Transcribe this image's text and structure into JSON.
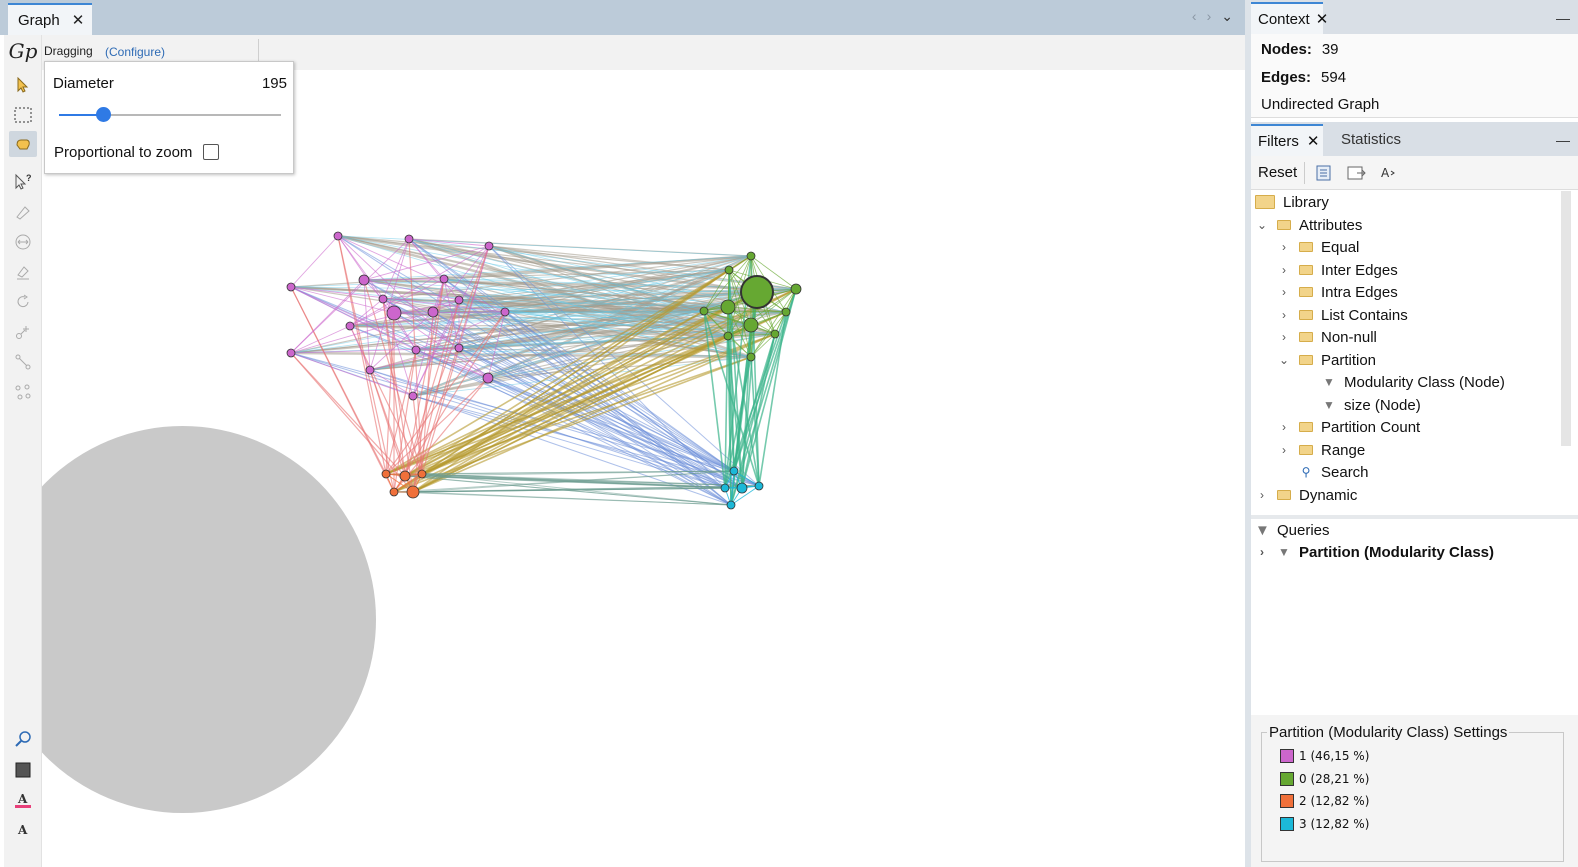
{
  "graph_tab": {
    "title": "Graph",
    "close": "✕"
  },
  "nav": {
    "prev": "‹",
    "next": "›",
    "menu": "⌄"
  },
  "tools": {
    "logo": "Gp",
    "items": [
      "select-arrow-icon",
      "rectangle-select-icon",
      "drag-hand-icon",
      "help-pointer-icon",
      "painter-icon",
      "resize-icon",
      "brush-icon",
      "rotate-icon",
      "add-node-icon",
      "add-edge-icon",
      "shortest-path-icon"
    ]
  },
  "bottom_tools": [
    "zoom-fit-icon",
    "background-color-icon",
    "label-color-icon",
    "label-font-icon"
  ],
  "topbar": {
    "mode": "Dragging",
    "configure": "(Configure)"
  },
  "drag_popup": {
    "diameter_label": "Diameter",
    "diameter_value": "195",
    "slider_fraction": 0.2,
    "proportional_label": "Proportional to zoom",
    "proportional_checked": false
  },
  "context": {
    "tab": "Context",
    "nodes_label": "Nodes:",
    "nodes_value": "39",
    "edges_label": "Edges:",
    "edges_value": "594",
    "graph_type": "Undirected Graph"
  },
  "filters": {
    "tab": "Filters",
    "stats_tab": "Statistics",
    "reset": "Reset",
    "tree": {
      "library": "Library",
      "attributes": "Attributes",
      "equal": "Equal",
      "inter_edges": "Inter Edges",
      "intra_edges": "Intra Edges",
      "list_contains": "List Contains",
      "non_null": "Non-null",
      "partition": "Partition",
      "modularity": "Modularity Class (Node)",
      "size": "size (Node)",
      "partition_count": "Partition Count",
      "range": "Range",
      "search": "Search",
      "dynamic": "Dynamic"
    },
    "queries_label": "Queries",
    "query_item": "Partition (Modularity Class)"
  },
  "settings": {
    "title": "Partition (Modularity Class) Settings",
    "legend": [
      {
        "label": "1 (46,15 %)",
        "color": "#cc66cc"
      },
      {
        "label": "0 (28,21 %)",
        "color": "#66a832"
      },
      {
        "label": "2 (12,82 %)",
        "color": "#f0703a"
      },
      {
        "label": "3 (12,82 %)",
        "color": "#1cb8d8"
      }
    ]
  },
  "colors": {
    "cluster_pink": "#cc66cc",
    "cluster_green": "#66a832",
    "cluster_orange": "#f0703a",
    "cluster_cyan": "#1cb8d8",
    "edge_gray": "#a39a8c",
    "edge_olive": "#b59a2e",
    "edge_teal": "#3bb38a",
    "edge_blue": "#6c8ed8",
    "edge_lightblue": "#63c7e6",
    "edge_red": "#e87272"
  }
}
